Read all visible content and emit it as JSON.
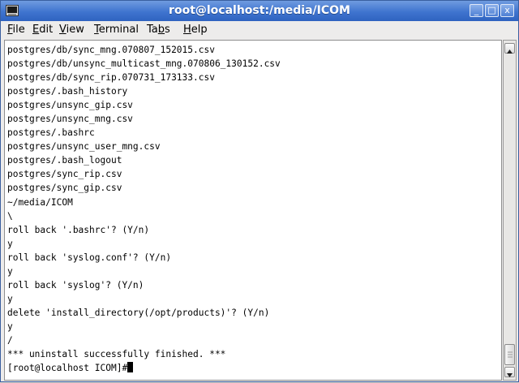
{
  "window": {
    "title": "root@localhost:/media/ICOM"
  },
  "titlebar_buttons": {
    "minimize": "_",
    "maximize": "□",
    "close": "x"
  },
  "menu": {
    "file": {
      "accel": "F",
      "rest": "ile"
    },
    "edit": {
      "accel": "E",
      "rest": "dit"
    },
    "view": {
      "accel": "V",
      "rest": "iew"
    },
    "terminal": {
      "pre": "",
      "accel": "T",
      "rest": "erminal"
    },
    "tabs": {
      "pre": "Ta",
      "accel": "b",
      "rest": "s"
    },
    "help": {
      "accel": "H",
      "rest": "elp"
    }
  },
  "terminal": {
    "text": "postgres/db/sync_mng.070807_152015.csv\npostgres/db/unsync_multicast_mng.070806_130152.csv\npostgres/db/sync_rip.070731_173133.csv\npostgres/.bash_history\npostgres/unsync_gip.csv\npostgres/unsync_mng.csv\npostgres/.bashrc\npostgres/unsync_user_mng.csv\npostgres/.bash_logout\npostgres/sync_rip.csv\npostgres/sync_gip.csv\n~/media/ICOM\n\\\nroll back '.bashrc'? (Y/n)\ny\nroll back 'syslog.conf'? (Y/n)\ny\nroll back 'syslog'? (Y/n)\ny\ndelete 'install_directory(/opt/products)'? (Y/n)\ny\n/\n*** uninstall successfully finished. ***",
    "prompt": "[root@localhost ICOM]#"
  },
  "scrollbar": {
    "position": 1.0
  },
  "colors": {
    "titlebar": "#3f74cf",
    "terminal_bg": "#ffffff",
    "terminal_fg": "#000000"
  }
}
